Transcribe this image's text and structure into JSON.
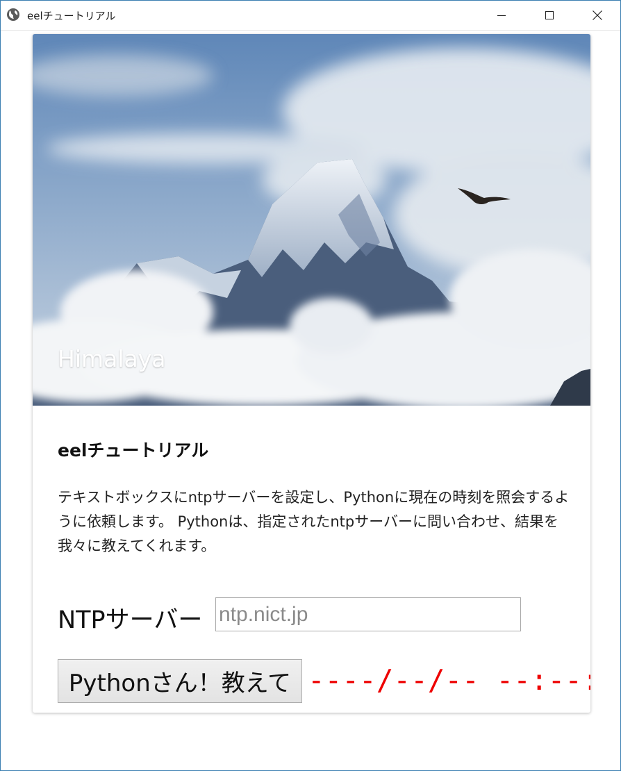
{
  "window": {
    "title": "eelチュートリアル",
    "icon": "globe-icon",
    "controls": [
      "minimize-icon",
      "maximize-icon",
      "close-icon"
    ]
  },
  "hero": {
    "title": "Himalaya",
    "image_subject": "snow-capped mountain peak above clouds with a flying bird"
  },
  "content": {
    "heading": "eelチュートリアル",
    "description": "テキストボックスにntpサーバーを設定し、Pythonに現在の時刻を照会するように依頼します。 Pythonは、指定されたntpサーバーに問い合わせ、結果を我々に教えてくれます。"
  },
  "form": {
    "ntp_label": "NTPサーバー",
    "ntp_placeholder": "ntp.nict.jp",
    "ntp_value": "",
    "button_label": "Pythonさん！教えて",
    "time_output": "----/--/-- --:--:--"
  },
  "colors": {
    "output_text": "#ee0000",
    "window_border": "#3c7fb1"
  }
}
